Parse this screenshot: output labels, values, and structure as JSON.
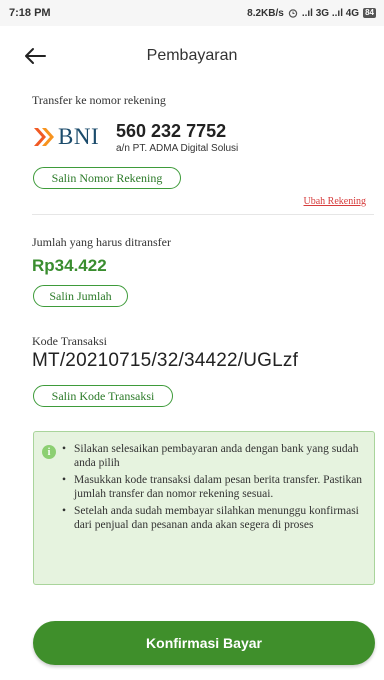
{
  "status_bar": {
    "time": "7:18 PM",
    "network_speed": "8.2KB/s",
    "signal_text": "..ıl 3G ..ıl 4G",
    "battery": "84"
  },
  "header": {
    "title": "Pembayaran"
  },
  "transfer": {
    "label": "Transfer ke nomor rekening",
    "bank_name": "BNI",
    "account_number": "560 232 7752",
    "account_holder": "a/n PT. ADMA Digital Solusi",
    "copy_account_label": "Salin Nomor Rekening",
    "change_account_label": "Ubah Rekening"
  },
  "amount": {
    "label": "Jumlah yang harus ditransfer",
    "value": "Rp34.422",
    "copy_label": "Salin Jumlah"
  },
  "transaction": {
    "label": "Kode Transaksi",
    "code": "MT/20210715/32/34422/UGLzf",
    "copy_label": "Salin Kode Transaksi"
  },
  "info": {
    "items": [
      "Silakan selesaikan pembayaran anda dengan bank yang sudah anda pilih",
      "Masukkan kode transaksi dalam pesan berita transfer. Pastikan jumlah transfer dan nomor rekening sesuai.",
      "Setelah anda sudah membayar silahkan menunggu konfirmasi dari penjual dan pesanan anda akan segera di proses"
    ]
  },
  "footer": {
    "confirm_label": "Konfirmasi Bayar"
  },
  "colors": {
    "primary_green": "#3f8f2b",
    "amount_green": "#3a8d2f",
    "info_bg": "#e6f3df",
    "link_red": "#d63b3b",
    "bni_orange": "#f15a24",
    "bni_blue": "#1b4b6b"
  },
  "icons": [
    "back-arrow-icon",
    "alarm-icon",
    "signal-icon",
    "battery-icon",
    "bni-logo-icon",
    "info-icon"
  ]
}
